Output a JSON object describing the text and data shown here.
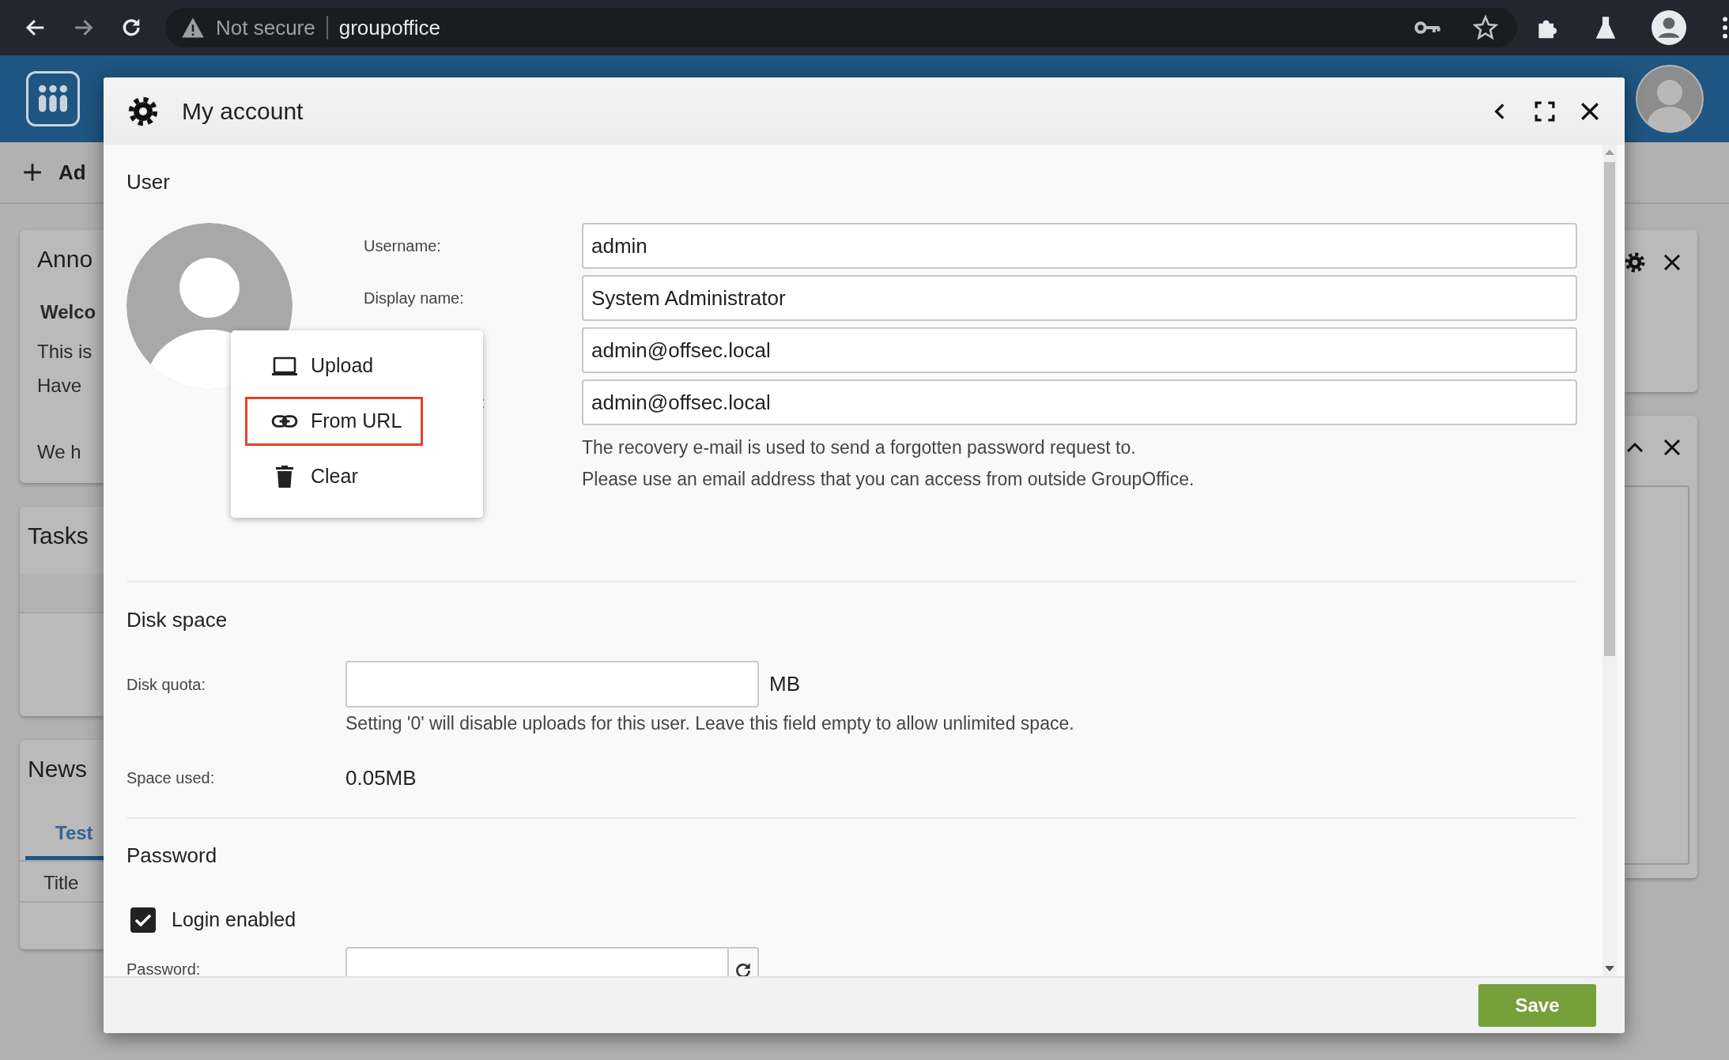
{
  "browser": {
    "security": "Not secure",
    "url": "groupoffice"
  },
  "background": {
    "add_button": "Ad",
    "announcements": {
      "title": "Anno",
      "heading": "Welco",
      "lines": [
        "This is",
        "Have"
      ],
      "footer": "We h"
    },
    "tasks": {
      "title": "Tasks"
    },
    "news": {
      "title": "News",
      "tabs": [
        {
          "label": "Test",
          "selected": true
        }
      ],
      "column": "Title"
    }
  },
  "dialog": {
    "title": "My account",
    "user": {
      "heading": "User",
      "fields": [
        {
          "kind": "labeled",
          "label": "Username:",
          "value": "admin"
        },
        {
          "kind": "labeled",
          "label": "Display name:",
          "value": "System Administrator"
        },
        {
          "kind": "masked",
          "value": "admin@offsec.local"
        },
        {
          "kind": "masked",
          "label": ":",
          "value": "admin@offsec.local"
        }
      ],
      "help": [
        "The recovery e-mail is used to send a forgotten password request to.",
        "Please use an email address that you can access from outside GroupOffice."
      ],
      "avatar_menu": [
        {
          "kind": "upload",
          "label": "Upload",
          "highlighted": false
        },
        {
          "kind": "url",
          "label": "From URL",
          "highlighted": true
        },
        {
          "kind": "clear",
          "label": "Clear",
          "highlighted": false
        }
      ]
    },
    "disk_space": {
      "heading": "Disk space",
      "quota_label": "Disk quota:",
      "unit": "MB",
      "help": "Setting '0' will disable uploads for this user. Leave this field empty to allow unlimited space.",
      "used_label": "Space used:",
      "used_value": "0.05MB"
    },
    "password": {
      "heading": "Password",
      "login_enabled": {
        "label": "Login enabled",
        "checked": true
      },
      "password_label": "Password:"
    },
    "save": "Save"
  }
}
